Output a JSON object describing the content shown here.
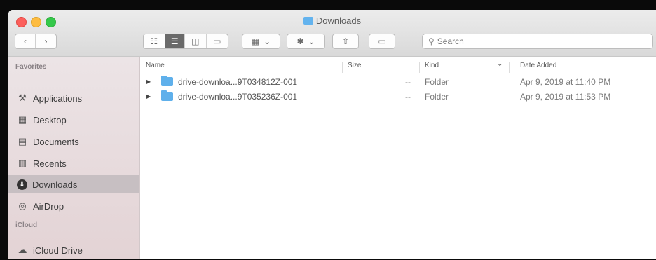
{
  "window": {
    "title": "Downloads"
  },
  "toolbar": {
    "nav_back": "‹",
    "nav_forward": "›",
    "view_icons": "☷",
    "view_list": "☰",
    "view_columns": "◫",
    "view_gallery": "▭",
    "group_label": "▦",
    "group_chevron": "⌄",
    "action_label": "✱",
    "action_chevron": "⌄",
    "share_label": "⇧",
    "tags_label": "▭"
  },
  "search": {
    "icon": "⚲",
    "placeholder": "Search"
  },
  "sidebar": {
    "favorites_header": "Favorites",
    "items": [
      {
        "label": "Applications",
        "icon": "⚒"
      },
      {
        "label": "Desktop",
        "icon": "▦"
      },
      {
        "label": "Documents",
        "icon": "▤"
      },
      {
        "label": "Recents",
        "icon": "▥"
      },
      {
        "label": "Downloads",
        "icon": "⬇"
      },
      {
        "label": "AirDrop",
        "icon": "◎"
      }
    ],
    "icloud_header": "iCloud",
    "icloud_items": [
      {
        "label": "iCloud Drive",
        "icon": "☁"
      }
    ]
  },
  "columns": {
    "name": "Name",
    "size": "Size",
    "kind": "Kind",
    "date_added": "Date Added",
    "sort_indicator": "⌄"
  },
  "files": [
    {
      "name": "drive-downloa...9T034812Z-001",
      "size": "--",
      "kind": "Folder",
      "date_added": "Apr 9, 2019 at 11:40 PM"
    },
    {
      "name": "drive-downloa...9T035236Z-001",
      "size": "--",
      "kind": "Folder",
      "date_added": "Apr 9, 2019 at 11:53 PM"
    }
  ],
  "colors": {
    "sidebar_bg": "#e8dcde",
    "selection": "#c7bfc2",
    "folder_blue": "#5fb0eb"
  }
}
